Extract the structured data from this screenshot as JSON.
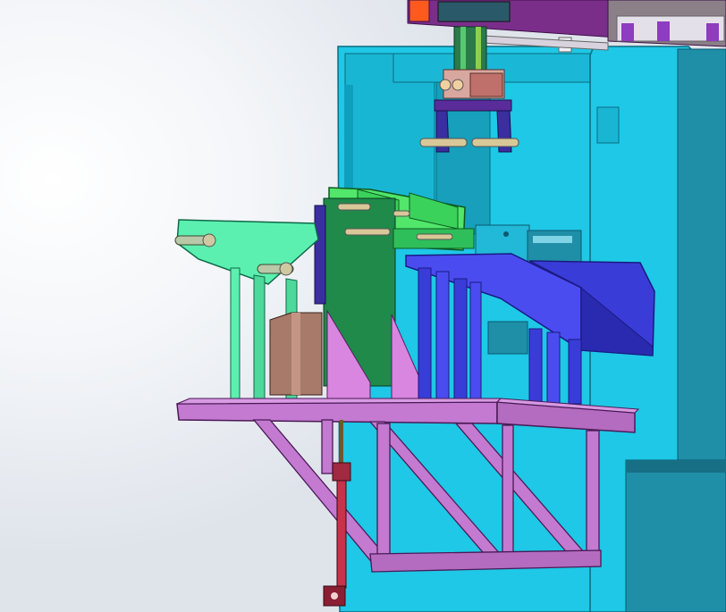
{
  "scene": {
    "title": "",
    "colors": {
      "cyan_frame": "#1ec8e6",
      "cyan_dark": "#0e9fbd",
      "teal_tower": "#1f8fa8",
      "teal_tower_dark": "#166f85",
      "violet_table": "#c37ad0",
      "violet_dark": "#8f4d9c",
      "blue_chute": "#3a3cd8",
      "blue_chute_dark": "#2a2ab0",
      "mint_plate": "#5cf0b0",
      "green_block": "#1f8a4a",
      "light_green": "#52e66a",
      "pink_block": "#d986e0",
      "brown_block": "#a87a6a",
      "red_rod": "#c8324a",
      "purple_top": "#7a2e8a",
      "orange_tag": "#ff5a1e"
    },
    "components": [
      "conveyor-frame",
      "pedestal-tower",
      "gripper-head",
      "clamp-fixture",
      "feed-plate",
      "blue-chute",
      "support-table",
      "truss-bracket",
      "air-cylinder"
    ]
  }
}
